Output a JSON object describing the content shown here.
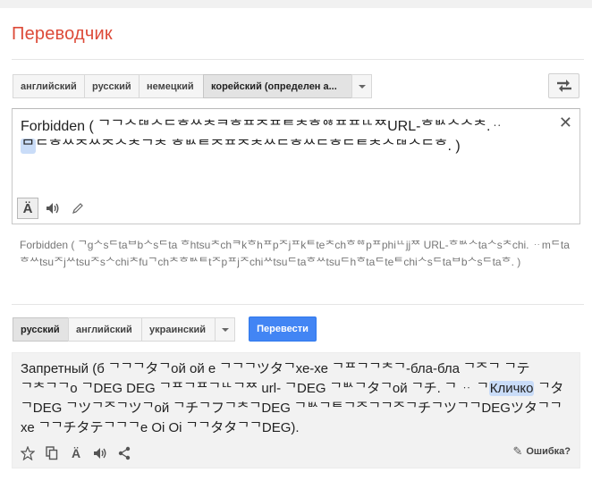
{
  "app": {
    "title": "Переводчик"
  },
  "source": {
    "languages": [
      "английский",
      "русский",
      "немецкий",
      "корейский (определен а..."
    ],
    "text_before_highlight": "Forbidden ( ᄀᄀᄉᄃᄇᄉᄃᄒᄊᄎᄏᄒᄑᄌᄑᄐᄎᄒᄋᄒᄑᄑᄔᄍURL-ᄒᄡᄉᄉᄎ.ᆢ",
    "text_highlight": "ᄆ",
    "text_after_highlight": "ᄃᄒᄊᄌᄊᄌᄉᄎᄀᄎ ᄒᄡᄐᄌᄑᄌᄎᄊᄃᄒᄊᄃᄒᄃᄐᄎᄉᄃᄇᄉᄃᄒ. )",
    "clear_label": "✕"
  },
  "transliteration": "Forbidden ( ᄀgᄉsᄃtaᄇbᄉsᄃta ᄒhtsuᄎchᄏkᄒhᄑpᄌjᄑkᄐteᄎchᄒᄋᄒpᄑphiᄔjjᄍ URL-ᄒᄡᄉtaᄉsᄎchi. ᆢmᄃtaᄒᄊtsuᄌjᄊtsuᄌsᄉchiᄎfuᄀchᄎᄒᄡᄐtᄌpᄑjᄌchiᄊtsuᄃtaᄒᄊtsuᄃhᄒtaᄃteᄐchiᄉsᄃtaᄇbᄉsᄃtaᄒ. )",
  "target": {
    "languages": [
      "русский",
      "английский",
      "украинский"
    ],
    "translate_label": "Перевести",
    "text_before_highlight": "Запретный (б ᄀᄀᄀタᄀой ой е ᄀᄀᄀツタᄀхе-хе ᄀᄑᄀᄀᄎᄀ-бла-бла ᄀᄌᄀ ᄀテᄀᄎᄀᄀo ᄀDEG DEG ᄀᄑᄀᄑᄀᄔᄀᄍ url- ᄀDEG ᄀᄡᄀタᄀой ᄀチ. ᄀ ᆢ ᄀ",
    "text_highlight": "Кличко",
    "text_after_highlight": " ᄀタᄀDEG ᄀツᄀᄌᄀツᄀой ᄀチᄀフᄀᄎᄀDEG ᄀᄡᄀᄐᄀᄌᄀᄀᄌᄀチᄀツᄀᄀDEGツタᄀᄀхе ᄀᄀチタテᄀᄀᄀe Oi Oi ᄀᄀタタᄀᄀDEG).",
    "feedback_label": "Ошибка?"
  },
  "icons": {
    "swap": "swap-languages-icon",
    "transliteration": "transliteration-icon",
    "listen": "speaker-icon",
    "handwriting": "pencil-icon",
    "star": "star-icon",
    "copy": "copy-icon",
    "share": "share-icon"
  },
  "colors": {
    "title": "#dd4b39",
    "translate_button": "#4285f4",
    "highlight": "#c9dcf8",
    "result_background": "#f2f2f2"
  }
}
